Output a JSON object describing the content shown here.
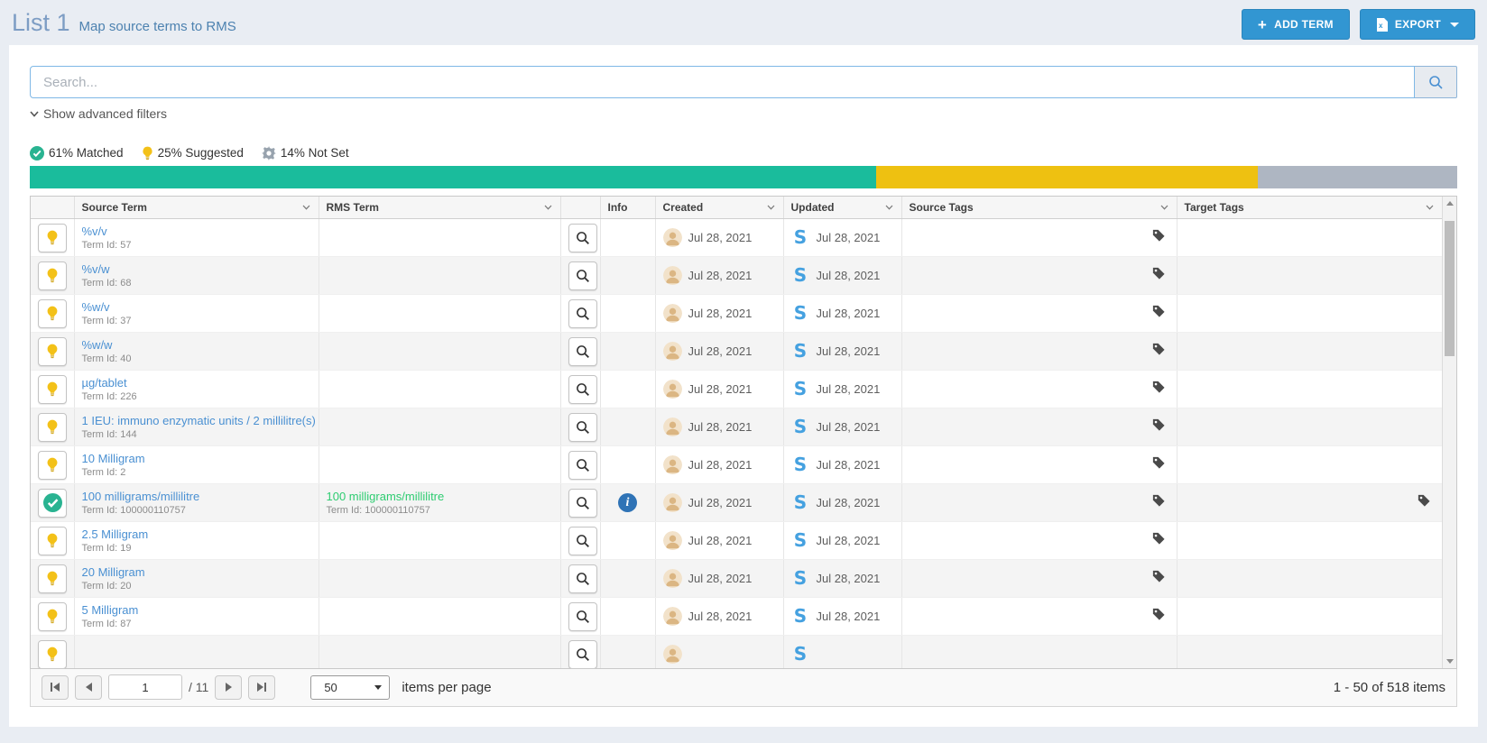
{
  "header": {
    "title": "List 1",
    "subtitle": "Map source terms to RMS"
  },
  "toolbar": {
    "add_term": "ADD TERM",
    "export": "EXPORT"
  },
  "search": {
    "placeholder": "Search...",
    "value": ""
  },
  "filters": {
    "toggle_label": "Show advanced filters"
  },
  "chart_data": {
    "type": "bar",
    "title": "Mapping status progress",
    "segments": [
      {
        "key": "matched",
        "label": "61% Matched",
        "pct": 61,
        "width_pct": 59.3,
        "color": "#1abc9c"
      },
      {
        "key": "suggested",
        "label": "25% Suggested",
        "pct": 25,
        "width_pct": 26.7,
        "color": "#eec111"
      },
      {
        "key": "not_set",
        "label": "14% Not Set",
        "pct": 14,
        "width_pct": 14.0,
        "color": "#aeb6c2"
      }
    ]
  },
  "table": {
    "columns": [
      {
        "label": ""
      },
      {
        "label": "Source Term"
      },
      {
        "label": "RMS Term"
      },
      {
        "label": ""
      },
      {
        "label": "Info"
      },
      {
        "label": "Created"
      },
      {
        "label": "Updated"
      },
      {
        "label": "Source Tags"
      },
      {
        "label": "Target Tags"
      }
    ],
    "rows": [
      {
        "status": "suggested",
        "source_term": "%v/v",
        "source_term_id": "Term Id: 57",
        "rms_term": "",
        "rms_term_id": "",
        "created": "Jul 28, 2021",
        "updated": "Jul 28, 2021",
        "has_info": false,
        "source_tag": true,
        "target_tag": false
      },
      {
        "status": "suggested",
        "source_term": "%v/w",
        "source_term_id": "Term Id: 68",
        "rms_term": "",
        "rms_term_id": "",
        "created": "Jul 28, 2021",
        "updated": "Jul 28, 2021",
        "has_info": false,
        "source_tag": true,
        "target_tag": false
      },
      {
        "status": "suggested",
        "source_term": "%w/v",
        "source_term_id": "Term Id: 37",
        "rms_term": "",
        "rms_term_id": "",
        "created": "Jul 28, 2021",
        "updated": "Jul 28, 2021",
        "has_info": false,
        "source_tag": true,
        "target_tag": false
      },
      {
        "status": "suggested",
        "source_term": "%w/w",
        "source_term_id": "Term Id: 40",
        "rms_term": "",
        "rms_term_id": "",
        "created": "Jul 28, 2021",
        "updated": "Jul 28, 2021",
        "has_info": false,
        "source_tag": true,
        "target_tag": false
      },
      {
        "status": "suggested",
        "source_term": "µg/tablet",
        "source_term_id": "Term Id: 226",
        "rms_term": "",
        "rms_term_id": "",
        "created": "Jul 28, 2021",
        "updated": "Jul 28, 2021",
        "has_info": false,
        "source_tag": true,
        "target_tag": false
      },
      {
        "status": "suggested",
        "source_term": "1 IEU: immuno enzymatic units / 2 millilitre(s)",
        "source_term_id": "Term Id: 144",
        "rms_term": "",
        "rms_term_id": "",
        "created": "Jul 28, 2021",
        "updated": "Jul 28, 2021",
        "has_info": false,
        "source_tag": true,
        "target_tag": false
      },
      {
        "status": "suggested",
        "source_term": "10 Milligram",
        "source_term_id": "Term Id: 2",
        "rms_term": "",
        "rms_term_id": "",
        "created": "Jul 28, 2021",
        "updated": "Jul 28, 2021",
        "has_info": false,
        "source_tag": true,
        "target_tag": false
      },
      {
        "status": "matched",
        "source_term": "100 milligrams/millilitre",
        "source_term_id": "Term Id: 100000110757",
        "rms_term": "100 milligrams/millilitre",
        "rms_term_id": "Term Id: 100000110757",
        "created": "Jul 28, 2021",
        "updated": "Jul 28, 2021",
        "has_info": true,
        "source_tag": true,
        "target_tag": true
      },
      {
        "status": "suggested",
        "source_term": "2.5 Milligram",
        "source_term_id": "Term Id: 19",
        "rms_term": "",
        "rms_term_id": "",
        "created": "Jul 28, 2021",
        "updated": "Jul 28, 2021",
        "has_info": false,
        "source_tag": true,
        "target_tag": false
      },
      {
        "status": "suggested",
        "source_term": "20 Milligram",
        "source_term_id": "Term Id: 20",
        "rms_term": "",
        "rms_term_id": "",
        "created": "Jul 28, 2021",
        "updated": "Jul 28, 2021",
        "has_info": false,
        "source_tag": true,
        "target_tag": false
      },
      {
        "status": "suggested",
        "source_term": "5 Milligram",
        "source_term_id": "Term Id: 87",
        "rms_term": "",
        "rms_term_id": "",
        "created": "Jul 28, 2021",
        "updated": "Jul 28, 2021",
        "has_info": false,
        "source_tag": true,
        "target_tag": false
      },
      {
        "status": "suggested",
        "source_term": "",
        "source_term_id": "",
        "rms_term": "",
        "rms_term_id": "",
        "created": "",
        "updated": "",
        "has_info": false,
        "source_tag": false,
        "target_tag": false
      }
    ]
  },
  "pagination": {
    "page": "1",
    "of_pages": "/ 11",
    "page_size": "50",
    "per_page_label": "items per page",
    "range_label": "1 - 50 of 518 items"
  }
}
